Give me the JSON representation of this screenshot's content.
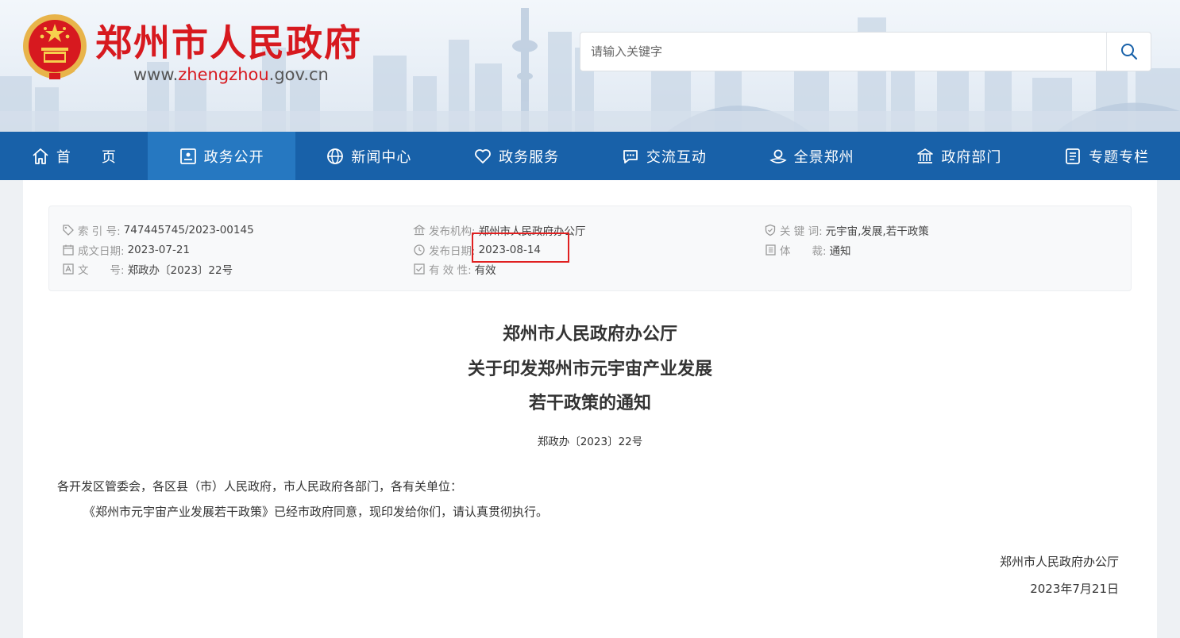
{
  "header": {
    "site_title": "郑州市人民政府",
    "url_prefix": "www.",
    "url_highlight": "zhengzhou",
    "url_suffix": ".gov.cn",
    "search": {
      "placeholder": "请输入关键字",
      "value": ""
    },
    "colors": {
      "brand_red": "#d7191f",
      "nav_blue": "#1861a9",
      "nav_active": "#2678c1"
    }
  },
  "nav": {
    "items": [
      {
        "label": "首　　页",
        "icon": "home-icon"
      },
      {
        "label": "政务公开",
        "icon": "document-badge-icon",
        "active": true
      },
      {
        "label": "新闻中心",
        "icon": "globe-icon"
      },
      {
        "label": "政务服务",
        "icon": "heart-icon"
      },
      {
        "label": "交流互动",
        "icon": "chat-icon"
      },
      {
        "label": "全景郑州",
        "icon": "panorama-icon"
      },
      {
        "label": "政府部门",
        "icon": "government-building-icon"
      },
      {
        "label": "专题专栏",
        "icon": "list-icon"
      }
    ]
  },
  "meta": {
    "index_key": "索 引 号:",
    "index_value": "747445745/2023-00145",
    "written_date_key": "成文日期:",
    "written_date_value": "2023-07-21",
    "doc_no_key": "文　　号:",
    "doc_no_value": "郑政办〔2023〕22号",
    "publisher_key": "发布机构:",
    "publisher_value": "郑州市人民政府办公厅",
    "publish_date_key": "发布日期:",
    "publish_date_value": "2023-08-14",
    "validity_key": "有 效 性:",
    "validity_value": "有效",
    "keywords_key": "关 键 词:",
    "keywords_value": "元宇宙,发展,若干政策",
    "genre_key": "体　　裁:",
    "genre_value": "通知"
  },
  "document": {
    "title_line1": "郑州市人民政府办公厅",
    "title_line2": "关于印发郑州市元宇宙产业发展",
    "title_line3": "若干政策的通知",
    "number": "郑政办〔2023〕22号",
    "salutation": "各开发区管委会，各区县（市）人民政府，市人民政府各部门，各有关单位：",
    "body": "《郑州市元宇宙产业发展若干政策》已经市政府同意，现印发给你们，请认真贯彻执行。",
    "signer": "郑州市人民政府办公厅",
    "date": "2023年7月21日"
  }
}
